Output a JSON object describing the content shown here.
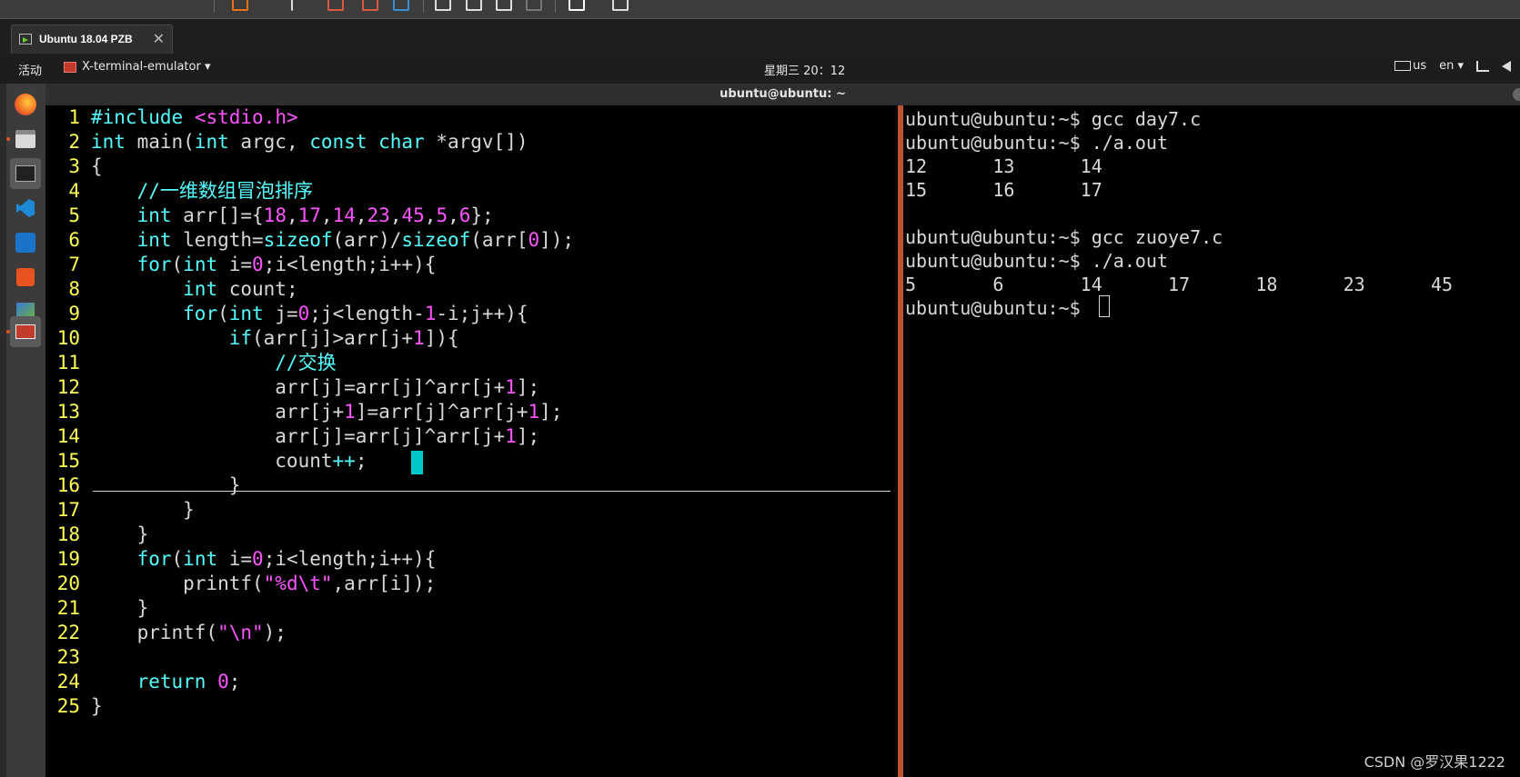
{
  "vm_tab": {
    "label": "Ubuntu 18.04 PZB",
    "close_glyph": "✕"
  },
  "top_bar": {
    "activities": "活动",
    "app_name": "X-terminal-emulator ▾",
    "clock": "星期三 20：12",
    "keyboard_layout": "us",
    "input_method": "en ▾",
    "network_icon": "network-icon",
    "volume_icon": "volume-icon"
  },
  "dock": {
    "items": [
      "firefox-icon",
      "files-icon",
      "terminal-icon",
      "vscode-icon",
      "vc-icon",
      "software-icon",
      "settings-icon",
      "x-terminal-icon"
    ]
  },
  "terminal": {
    "title": "ubuntu@ubuntu: ~"
  },
  "editor": {
    "line_numbers": [
      "1",
      "2",
      "3",
      "4",
      "5",
      "6",
      "7",
      "8",
      "9",
      "10",
      "11",
      "12",
      "13",
      "14",
      "15",
      "16",
      "17",
      "18",
      "19",
      "20",
      "21",
      "22",
      "23",
      "24",
      "25"
    ]
  },
  "shell": {
    "lines": [
      "ubuntu@ubuntu:~$ gcc day7.c",
      "ubuntu@ubuntu:~$ ./a.out",
      "12      13      14",
      "15      16      17",
      "",
      "ubuntu@ubuntu:~$ gcc zuoye7.c",
      "ubuntu@ubuntu:~$ ./a.out",
      "5       6       14      17      18      23      45",
      "ubuntu@ubuntu:~$ "
    ]
  },
  "watermark": "CSDN @罗汉果1222"
}
